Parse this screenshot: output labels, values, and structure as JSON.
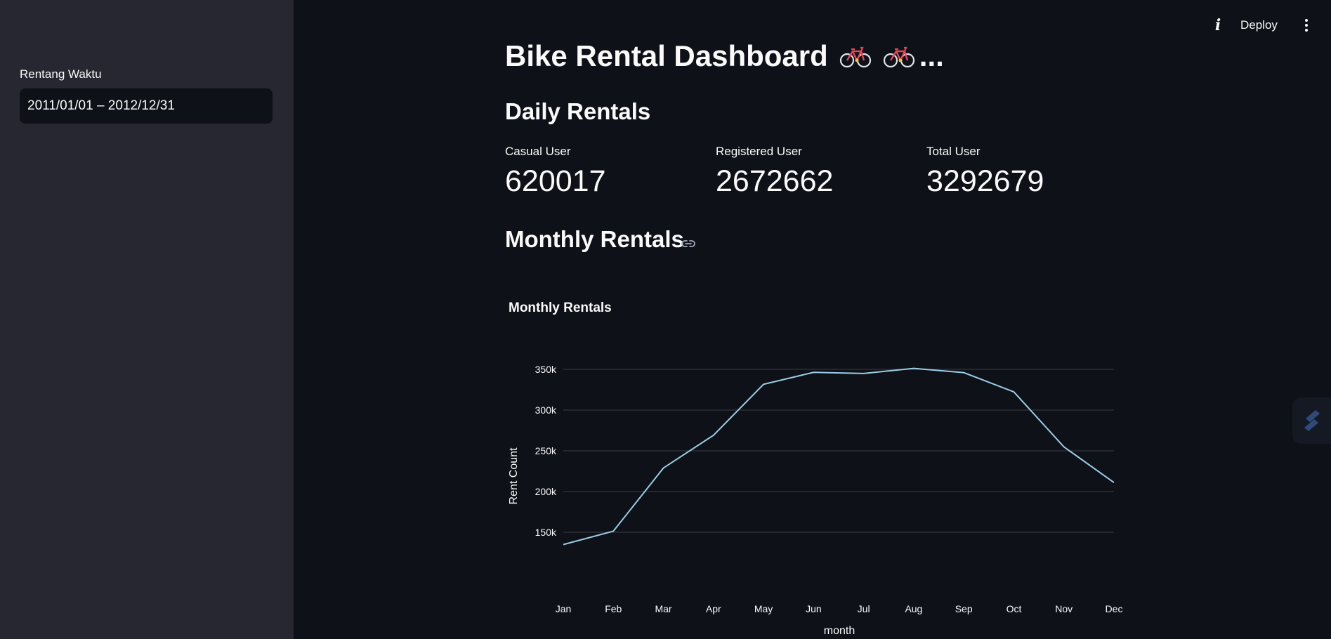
{
  "sidebar": {
    "date_range_label": "Rentang Waktu",
    "date_range_value": "2011/01/01 – 2012/12/31"
  },
  "topbar": {
    "deploy_label": "Deploy"
  },
  "main": {
    "title": "Bike Rental Dashboard",
    "title_suffix": "...",
    "daily_section_title": "Daily Rentals",
    "monthly_section_title": "Monthly Rentals",
    "metrics": [
      {
        "label": "Casual User",
        "value": "620017"
      },
      {
        "label": "Registered User",
        "value": "2672662"
      },
      {
        "label": "Total User",
        "value": "3292679"
      }
    ]
  },
  "colors": {
    "background": "#0e1117",
    "sidebar": "#262730",
    "line": "#9ccde9"
  },
  "chart_data": {
    "type": "line",
    "title": "Monthly Rentals",
    "xlabel": "month",
    "ylabel": "Rent Count",
    "categories": [
      "Jan",
      "Feb",
      "Mar",
      "Apr",
      "May",
      "Jun",
      "Jul",
      "Aug",
      "Sep",
      "Oct",
      "Nov",
      "Dec"
    ],
    "series": [
      {
        "values": [
          134933,
          151352,
          228920,
          269094,
          331686,
          346342,
          344948,
          351194,
          345991,
          322352,
          254831,
          211036
        ]
      }
    ],
    "yticks": [
      150000,
      200000,
      250000,
      300000,
      350000
    ],
    "ytick_labels": [
      "150k",
      "200k",
      "250k",
      "300k",
      "350k"
    ],
    "grid": true
  }
}
